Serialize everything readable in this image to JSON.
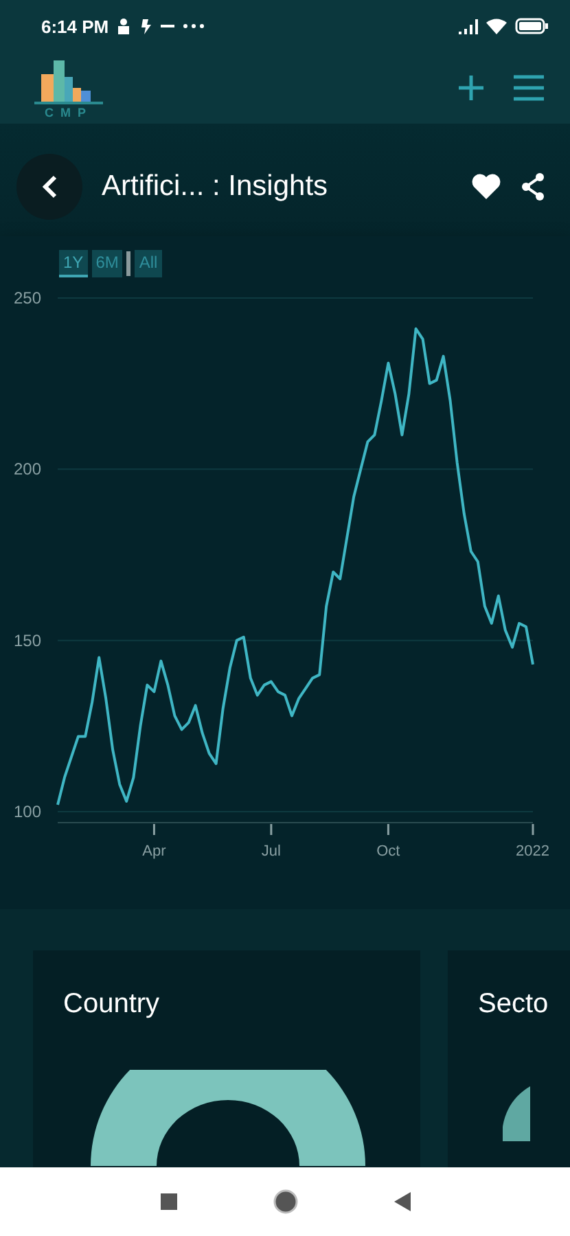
{
  "status_bar": {
    "time": "6:14 PM"
  },
  "header": {
    "logo_text": "CMP"
  },
  "title_bar": {
    "title": "Artifici... : Insights"
  },
  "range_buttons": [
    {
      "label": "1Y",
      "selected": true
    },
    {
      "label": "6M",
      "selected": false
    },
    {
      "label": "All",
      "selected": false
    }
  ],
  "chart_data": {
    "type": "line",
    "categories": [
      null,
      null,
      null,
      null,
      null,
      null,
      null,
      null,
      null,
      null,
      null,
      null,
      null,
      null,
      "Apr",
      null,
      null,
      null,
      null,
      null,
      null,
      null,
      null,
      null,
      null,
      null,
      null,
      null,
      null,
      null,
      null,
      "Jul",
      null,
      null,
      null,
      null,
      null,
      null,
      null,
      null,
      null,
      null,
      null,
      null,
      null,
      null,
      null,
      null,
      "Oct",
      null,
      null,
      null,
      null,
      null,
      null,
      null,
      null,
      null,
      null,
      null,
      null,
      null,
      null,
      null,
      null,
      null,
      null,
      null,
      null,
      "2022"
    ],
    "series": [
      {
        "color": "#3fb6c4",
        "values": [
          102,
          110,
          116,
          122,
          122,
          132,
          145,
          133,
          118,
          108,
          103,
          110,
          125,
          137,
          135,
          144,
          137,
          128,
          124,
          126,
          131,
          123,
          117,
          114,
          130,
          142,
          150,
          151,
          139,
          134,
          137,
          138,
          135,
          134,
          128,
          133,
          136,
          139,
          140,
          160,
          170,
          168,
          180,
          192,
          200,
          208,
          210,
          220,
          231,
          222,
          210,
          222,
          241,
          238,
          225,
          226,
          233,
          220,
          202,
          187,
          176,
          173,
          160,
          155,
          163,
          153,
          148,
          155,
          154,
          143
        ]
      }
    ],
    "ylim": [
      97,
      250
    ],
    "grid": true,
    "yticks": [
      100,
      150,
      200,
      250
    ]
  },
  "cards": [
    {
      "title": "Country"
    },
    {
      "title": "Secto"
    }
  ]
}
